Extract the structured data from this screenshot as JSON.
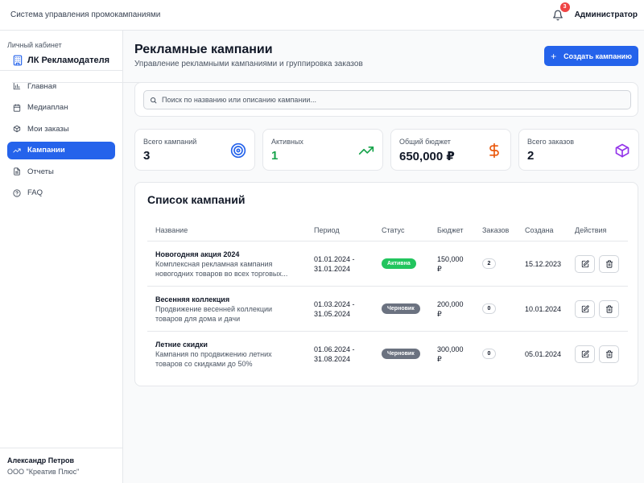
{
  "topbar": {
    "system_title": "Система управления промокампаниями",
    "notifications_count": "3",
    "user_role": "Администратор"
  },
  "sidebar": {
    "brand_name": "ЛК Рекламодателя",
    "brand_sub": "Личный кабинет",
    "items": [
      {
        "label": "Главная",
        "icon": "bar-chart-icon"
      },
      {
        "label": "Медиаплан",
        "icon": "calendar-icon"
      },
      {
        "label": "Мои заказы",
        "icon": "package-icon"
      },
      {
        "label": "Кампании",
        "icon": "trending-up-icon",
        "active": true
      },
      {
        "label": "Отчеты",
        "icon": "file-text-icon"
      },
      {
        "label": "FAQ",
        "icon": "help-circle-icon"
      }
    ],
    "user_name": "Александр Петров",
    "user_org": "ООО \"Креатив Плюс\""
  },
  "header": {
    "title": "Рекламные кампании",
    "subtitle": "Управление рекламными кампаниями и группировка заказов",
    "create_button": "Создать кампанию"
  },
  "search": {
    "placeholder": "Поиск по названию или описанию кампании..."
  },
  "stats": [
    {
      "label": "Всего кампаний",
      "value": "3",
      "icon": "target-icon",
      "color": "#2563eb"
    },
    {
      "label": "Активных",
      "value": "1",
      "icon": "trending-up-icon",
      "color": "#16a34a"
    },
    {
      "label": "Общий бюджет",
      "value": "650,000 ₽",
      "icon": "dollar-icon",
      "color": "#ea580c"
    },
    {
      "label": "Всего заказов",
      "value": "2",
      "icon": "package-icon",
      "color": "#9333ea"
    }
  ],
  "campaigns": {
    "title": "Список кампаний",
    "columns": [
      "Название",
      "Период",
      "Статус",
      "Бюджет",
      "Заказов",
      "Создана",
      "Действия"
    ],
    "rows": [
      {
        "name": "Новогодняя акция 2024",
        "description": "Комплексная рекламная кампания новогодних товаров во всех торговых...",
        "period_start": "01.01.2024 -",
        "period_end": "31.01.2024",
        "status": "Активна",
        "budget": "150,000",
        "currency": "₽",
        "orders": "2",
        "created": "15.12.2023"
      },
      {
        "name": "Весенняя коллекция",
        "description": "Продвижение весенней коллекции товаров для дома и дачи",
        "period_start": "01.03.2024 -",
        "period_end": "31.05.2024",
        "status": "Черновик",
        "budget": "200,000",
        "currency": "₽",
        "orders": "0",
        "created": "10.01.2024"
      },
      {
        "name": "Летние скидки",
        "description": "Кампания по продвижению летних товаров со скидками до 50%",
        "period_start": "01.06.2024 -",
        "period_end": "31.08.2024",
        "status": "Черновик",
        "budget": "300,000",
        "currency": "₽",
        "orders": "0",
        "created": "05.01.2024"
      }
    ]
  },
  "colors": {
    "primary": "#2563eb",
    "active_status": "#22c55e",
    "draft_status": "#6b7280",
    "badge": "#ef4444"
  }
}
